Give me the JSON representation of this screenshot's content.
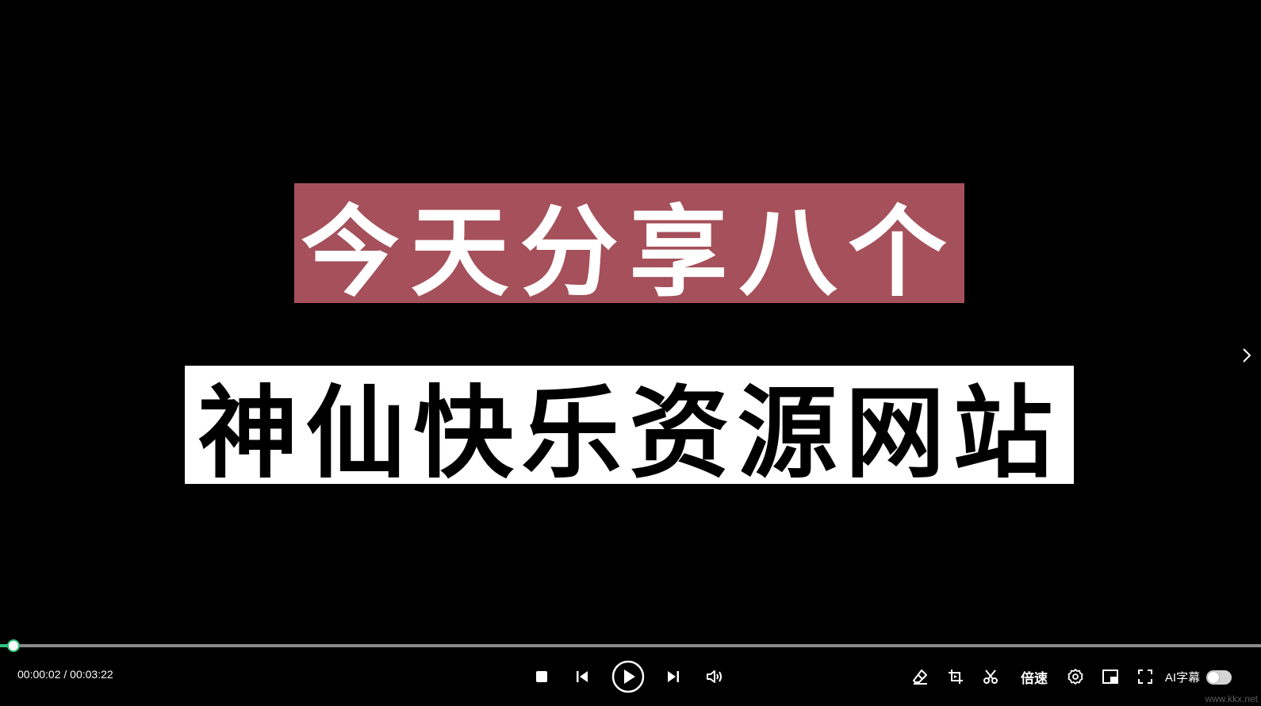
{
  "video": {
    "title_line1": "今天分享八个",
    "title_line2": "神仙快乐资源网站"
  },
  "player": {
    "current_time": "00:00:02",
    "total_time": "00:03:22",
    "time_display": "00:00:02 / 00:03:22",
    "progress_fraction": 0.01,
    "speed_label": "倍速",
    "ai_subtitle_label": "AI字幕",
    "ai_subtitle_enabled": false,
    "watermark": "www.kkx.net"
  },
  "icons": {
    "stop": "stop-icon",
    "previous": "skip-previous-icon",
    "play": "play-icon",
    "next": "skip-next-icon",
    "volume": "volume-icon",
    "annotate": "eraser-icon",
    "crop": "crop-icon",
    "cut": "scissors-icon",
    "settings": "gear-icon",
    "pip": "picture-in-picture-icon",
    "fullscreen": "fullscreen-icon",
    "side_next": "chevron-right-icon"
  },
  "colors": {
    "accent": "#2fc27a",
    "title_bg_1": "#a5505a",
    "title_bg_2": "#ffffff",
    "background": "#000000"
  }
}
